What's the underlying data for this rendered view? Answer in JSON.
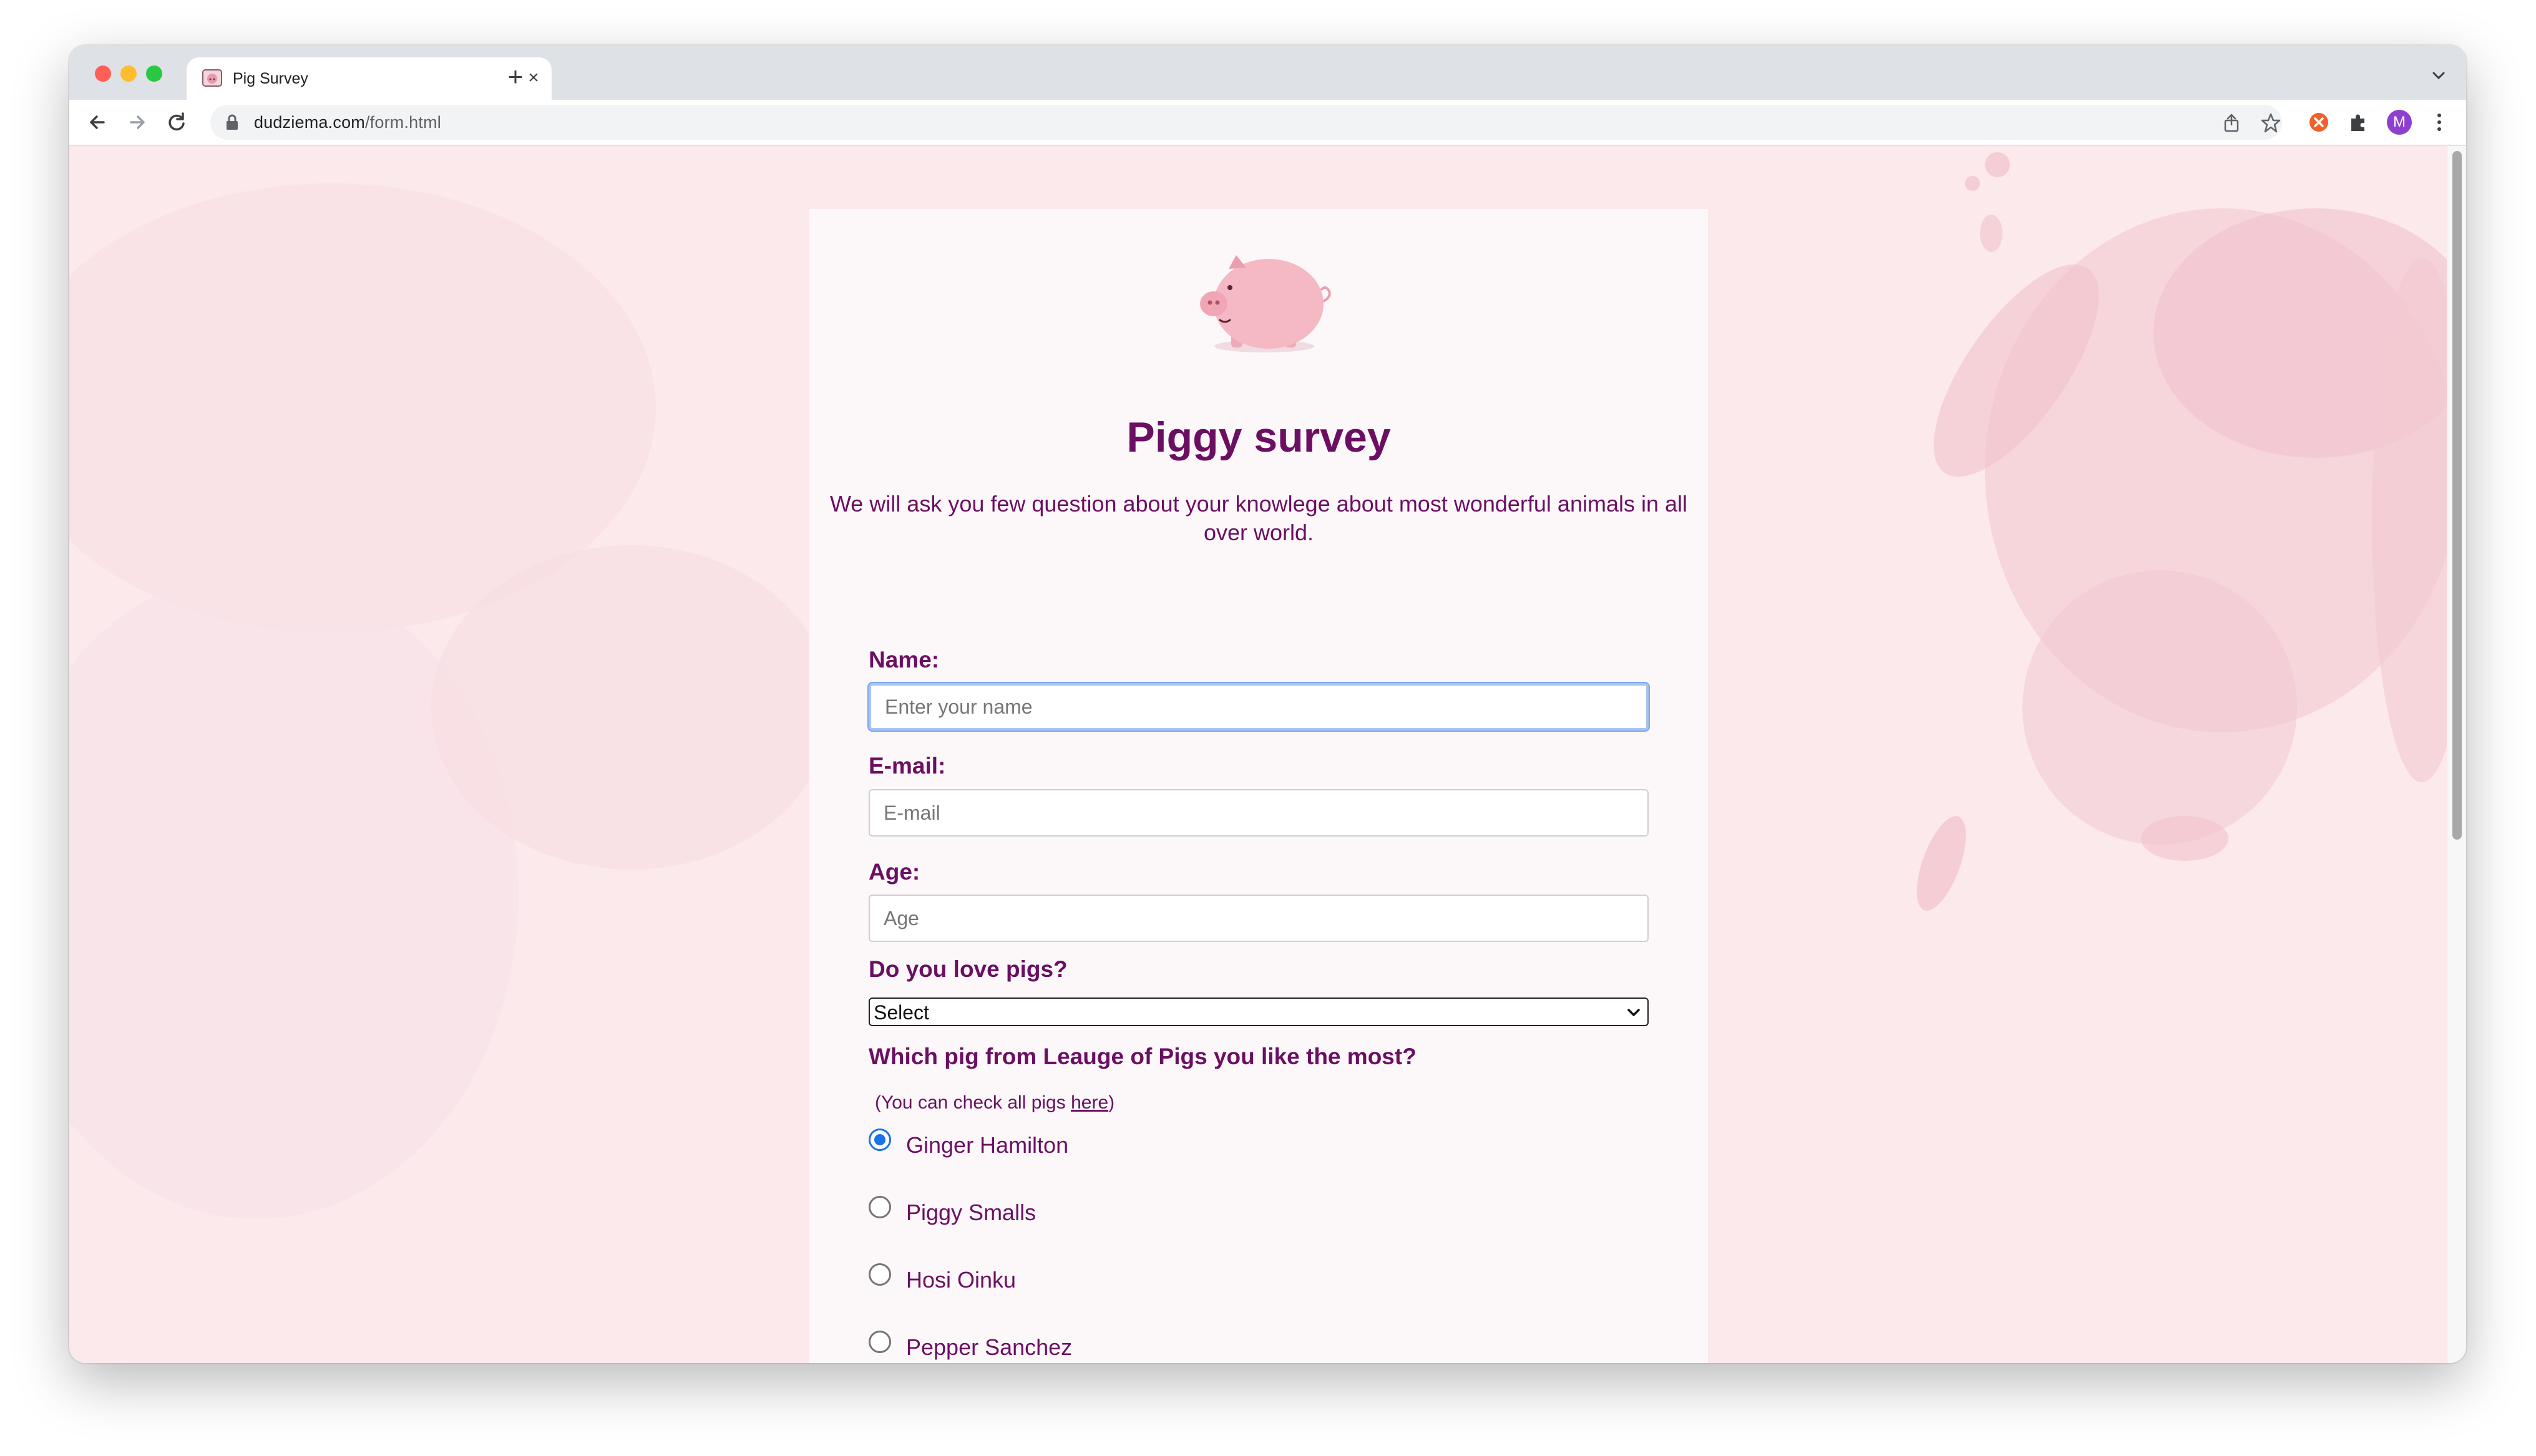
{
  "browser": {
    "tab_title": "Pig Survey",
    "url_host": "dudziema.com",
    "url_path": "/form.html",
    "profile_initial": "M"
  },
  "survey": {
    "title": "Piggy survey",
    "subtitle": "We will ask you few question about your knowlege about most wonderful animals in all over world.",
    "name_label": "Name:",
    "name_placeholder": "Enter your name",
    "email_label": "E-mail:",
    "email_placeholder": "E-mail",
    "age_label": "Age:",
    "age_placeholder": "Age",
    "love_label": "Do you love pigs?",
    "love_selected": "Select",
    "league_label": "Which pig from Leauge of Pigs you like the most?",
    "hint_prefix": "(You can check all pigs ",
    "hint_link": "here",
    "hint_suffix": ")",
    "options": [
      "Ginger Hamilton",
      "Piggy Smalls",
      "Hosi Oinku",
      "Pepper Sanchez"
    ],
    "selected_option": "Ginger Hamilton"
  },
  "colors": {
    "accent": "#6b0f63",
    "radio_checked": "#1a73e8",
    "background": "#fbe9ec"
  }
}
